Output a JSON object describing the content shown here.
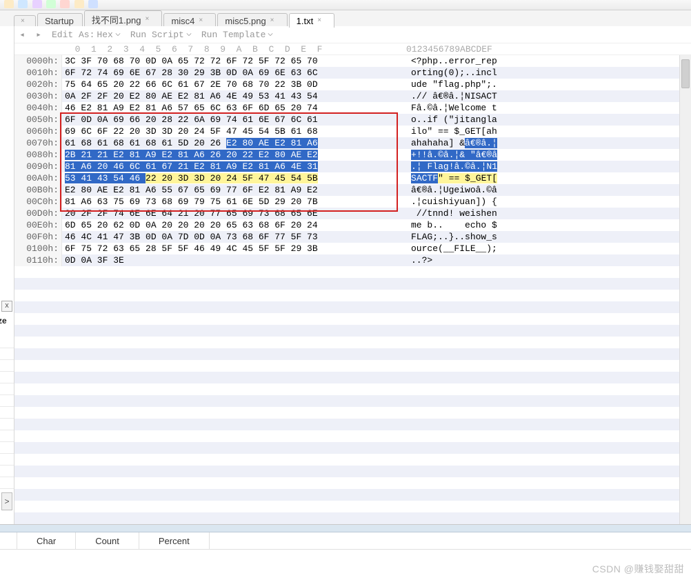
{
  "toolbar_icons": [
    "open",
    "save",
    "cut",
    "copy",
    "paste",
    "undo",
    "redo",
    "find",
    "goto",
    "calc",
    "options"
  ],
  "tabs": [
    {
      "label": "Startup",
      "active": false
    },
    {
      "label": "找不同1.png",
      "active": false
    },
    {
      "label": "misc4",
      "active": false
    },
    {
      "label": "misc5.png",
      "active": false
    },
    {
      "label": "1.txt",
      "active": true
    }
  ],
  "runbar": {
    "edit_as_label": "Edit As:",
    "edit_as_value": "Hex",
    "run_script_label": "Run Script",
    "run_template_label": "Run Template"
  },
  "hex_header_offsets": "  0  1  2  3  4  5  6  7  8  9  A  B  C  D  E  F",
  "ascii_header": "0123456789ABCDEF",
  "bottom_cols": {
    "c1": "Char",
    "c2": "Count",
    "c3": "Percent"
  },
  "watermark": "CSDN @赚钱娶甜甜",
  "close_x": "x",
  "ze_label": "ze",
  "chevron": ">",
  "rows": [
    {
      "addr": "0000h:",
      "hex": "3C 3F 70 68 70 0D 0A 65 72 72 6F 72 5F 72 65 70",
      "asc": "<?php..error_rep",
      "sel": []
    },
    {
      "addr": "0010h:",
      "hex": "6F 72 74 69 6E 67 28 30 29 3B 0D 0A 69 6E 63 6C",
      "asc": "orting(0);..incl",
      "sel": []
    },
    {
      "addr": "0020h:",
      "hex": "75 64 65 20 22 66 6C 61 67 2E 70 68 70 22 3B 0D",
      "asc": "ude \"flag.php\";.",
      "sel": []
    },
    {
      "addr": "0030h:",
      "hex": "0A 2F 2F 20 E2 80 AE E2 81 A6 4E 49 53 41 43 54",
      "asc": ".// â€®â.¦NISACT",
      "sel": []
    },
    {
      "addr": "0040h:",
      "hex": "46 E2 81 A9 E2 81 A6 57 65 6C 63 6F 6D 65 20 74",
      "asc": "Fâ.©â.¦Welcome t",
      "sel": []
    },
    {
      "addr": "0050h:",
      "hex": "6F 0D 0A 69 66 20 28 22 6A 69 74 61 6E 67 6C 61",
      "asc": "o..if (\"jitangla",
      "sel": []
    },
    {
      "addr": "0060h:",
      "hex": "69 6C 6F 22 20 3D 3D 20 24 5F 47 45 54 5B 61 68",
      "asc": "ilo\" == $_GET[ah",
      "sel": []
    },
    {
      "addr": "0070h:",
      "hex": "61 68 61 68 61 68 61 5D 20 26 E2 80 AE E2 81 A6",
      "asc": "ahahaha] &â€®â.¦",
      "sel": [
        {
          "type": "blue",
          "hs": 10,
          "he": 16,
          "as": 10,
          "ae": 16
        }
      ]
    },
    {
      "addr": "0080h:",
      "hex": "2B 21 21 E2 81 A9 E2 81 A6 26 20 22 E2 80 AE E2",
      "asc": "+!!â.©â.¦& \"â€®â",
      "sel": [
        {
          "type": "blue",
          "hs": 0,
          "he": 16,
          "as": 0,
          "ae": 16
        }
      ]
    },
    {
      "addr": "0090h:",
      "hex": "81 A6 20 46 6C 61 67 21 E2 81 A9 E2 81 A6 4E 31",
      "asc": ".¦ Flag!â.©â.¦N1",
      "sel": [
        {
          "type": "blue",
          "hs": 0,
          "he": 16,
          "as": 0,
          "ae": 16
        }
      ]
    },
    {
      "addr": "00A0h:",
      "hex": "53 41 43 54 46 22 20 3D 3D 20 24 5F 47 45 54 5B",
      "asc": "SACTF\" == $_GET[",
      "sel": [
        {
          "type": "blue",
          "hs": 0,
          "he": 5,
          "as": 0,
          "ae": 5
        },
        {
          "type": "yellow",
          "hs": 5,
          "he": 16,
          "as": 5,
          "ae": 16
        }
      ]
    },
    {
      "addr": "00B0h:",
      "hex": "E2 80 AE E2 81 A6 55 67 65 69 77 6F E2 81 A9 E2",
      "asc": "â€®â.¦Ugeiwoâ.©â",
      "sel": []
    },
    {
      "addr": "00C0h:",
      "hex": "81 A6 63 75 69 73 68 69 79 75 61 6E 5D 29 20 7B",
      "asc": ".¦cuishiyuan]) {",
      "sel": []
    },
    {
      "addr": "00D0h:",
      "hex": "20 2F 2F 74 6E 6E 64 21 20 77 65 69 73 68 65 6E",
      "asc": " //tnnd! weishen",
      "sel": []
    },
    {
      "addr": "00E0h:",
      "hex": "6D 65 20 62 0D 0A 20 20 20 20 65 63 68 6F 20 24",
      "asc": "me b..    echo $",
      "sel": []
    },
    {
      "addr": "00F0h:",
      "hex": "46 4C 41 47 3B 0D 0A 7D 0D 0A 73 68 6F 77 5F 73",
      "asc": "FLAG;..}..show_s",
      "sel": []
    },
    {
      "addr": "0100h:",
      "hex": "6F 75 72 63 65 28 5F 5F 46 49 4C 45 5F 5F 29 3B",
      "asc": "ource(__FILE__);",
      "sel": []
    },
    {
      "addr": "0110h:",
      "hex": "0D 0A 3F 3E",
      "asc": "..?>",
      "sel": []
    }
  ],
  "empty_rows": 24
}
